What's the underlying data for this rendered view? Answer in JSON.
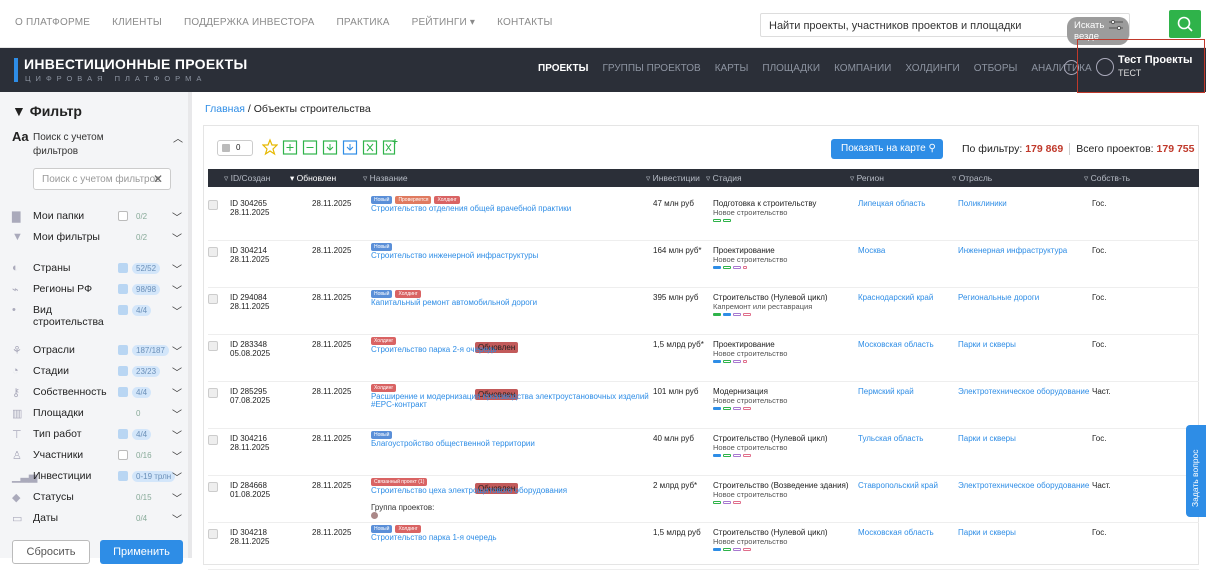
{
  "topnav": [
    "О ПЛАТФОРМЕ",
    "КЛИЕНТЫ",
    "ПОДДЕРЖКА ИНВЕСТОРА",
    "ПРАКТИКА",
    "РЕЙТИНГИ ▾",
    "КОНТАКТЫ"
  ],
  "search": {
    "placeholder": "Найти проекты, участников проектов и площадки",
    "scope": "Искать везде"
  },
  "logo": {
    "main": "ИНВЕСТИЦИОННЫЕ ПРОЕКТЫ",
    "sub": "ЦИФРОВАЯ ПЛАТФОРМА"
  },
  "mainnav": [
    "ПРОЕКТЫ",
    "ГРУППЫ ПРОЕКТОВ",
    "КАРТЫ",
    "ПЛОЩАДКИ",
    "КОМПАНИИ",
    "ХОЛДИНГИ",
    "ОТБОРЫ",
    "АНАЛИТИКА"
  ],
  "user": {
    "name": "Тест Проекты",
    "sub": "ТЕСТ"
  },
  "filter": {
    "title": "Фильтр",
    "aa": "Aa",
    "search_label1": "Поиск с учетом",
    "search_label2": "фильтров",
    "search_placeholder": "Поиск с учетом фильтров",
    "rows": [
      {
        "label": "Мои папки",
        "badge": "0/2"
      },
      {
        "label": "Мои фильтры",
        "badge": "0/2"
      },
      {
        "label": "Страны",
        "badge": "52/52"
      },
      {
        "label": "Регионы РФ",
        "badge": "98/98"
      },
      {
        "label": "Вид",
        "label2": "строительства",
        "badge": "4/4"
      },
      {
        "label": "Отрасли",
        "badge": "187/187"
      },
      {
        "label": "Стадии",
        "badge": "23/23"
      },
      {
        "label": "Собственность",
        "badge": "4/4"
      },
      {
        "label": "Площадки",
        "badge": "0"
      },
      {
        "label": "Тип работ",
        "badge": "4/4"
      },
      {
        "label": "Участники",
        "badge": "0/16"
      },
      {
        "label": "Инвестиции",
        "badge": "0-19 трлн"
      },
      {
        "label": "Статусы",
        "badge": "0/15"
      },
      {
        "label": "Даты",
        "badge": "0/4"
      }
    ],
    "reset": "Сбросить",
    "apply": "Применить"
  },
  "breadcrumb": {
    "home": "Главная",
    "sep": " / ",
    "current": "Объекты строительства"
  },
  "toolbar": {
    "selected": "0",
    "map": "Показать на карте"
  },
  "stats": {
    "label1": "По фильтру:",
    "v1": "179 869",
    "label2": "Всего проектов:",
    "v2": "179 755"
  },
  "columns": [
    "▿ ID/Создан",
    "▾ Обновлен",
    "▿ Название",
    "▿ Инвестиции",
    "▿ Стадия",
    "▿ Регион",
    "▿ Отрасль",
    "▿ Собств-ть"
  ],
  "rows": [
    {
      "id": "ID 304265",
      "date": "28.11.2025",
      "upd": "28.11.2025",
      "tags": [
        "Новый",
        "Проверяется",
        "Холдинг"
      ],
      "name": "Строительство отделения общей врачебной практики",
      "inv": "47 млн руб",
      "stage": "Подготовка к строительству",
      "stage2": "Новое строительство",
      "region": "Липецкая область",
      "industry": "Поликлиники",
      "own": "Гос."
    },
    {
      "id": "ID 304214",
      "date": "28.11.2025",
      "upd": "28.11.2025",
      "tags": [
        "Новый"
      ],
      "name": "Строительство инженерной инфраструктуры",
      "inv": "164 млн руб*",
      "stage": "Проектирование",
      "stage2": "Новое строительство",
      "region": "Москва",
      "industry": "Инженерная инфраструктура",
      "own": "Гос."
    },
    {
      "id": "ID 294084",
      "date": "28.11.2025",
      "upd": "28.11.2025",
      "tags": [
        "Новый",
        "Холдинг"
      ],
      "name": "Капитальный ремонт автомобильной дороги",
      "inv": "395 млн руб",
      "stage": "Строительство (Нулевой цикл)",
      "stage2": "Капремонт или реставрация",
      "region": "Краснодарский край",
      "industry": "Региональные дороги",
      "own": "Гос."
    },
    {
      "id": "ID 283348",
      "date": "05.08.2025",
      "upd": "28.11.2025",
      "tags": [
        "Обновлен",
        "Холдинг"
      ],
      "name": "Строительство парка 2-я очередь",
      "inv": "1,5 млрд руб*",
      "stage": "Проектирование",
      "stage2": "Новое строительство",
      "region": "Московская область",
      "industry": "Парки и скверы",
      "own": "Гос."
    },
    {
      "id": "ID 285295",
      "date": "07.08.2025",
      "upd": "28.11.2025",
      "tags": [
        "Обновлен",
        "Холдинг"
      ],
      "name": "Расширение и модернизация производства электроустановочных изделий",
      "name2": "#EPC-контракт",
      "inv": "101 млн руб",
      "stage": "Модернизация",
      "stage2": "Новое строительство",
      "region": "Пермский край",
      "industry": "Электротехническое оборудование",
      "own": "Част."
    },
    {
      "id": "ID 304216",
      "date": "28.11.2025",
      "upd": "28.11.2025",
      "tags": [
        "Новый"
      ],
      "name": "Благоустройство общественной территории",
      "inv": "40 млн руб",
      "stage": "Строительство (Нулевой цикл)",
      "stage2": "Новое строительство",
      "region": "Тульская область",
      "industry": "Парки и скверы",
      "own": "Гос."
    },
    {
      "id": "ID 284668",
      "date": "01.08.2025",
      "upd": "28.11.2025",
      "tags": [
        "Обновлен",
        "Связанный проект (1)"
      ],
      "name": "Строительство цеха электрощитового оборудования",
      "grp": "Группа проектов:",
      "inv": "2 млрд руб*",
      "stage": "Строительство (Возведение здания)",
      "stage2": "Новое строительство",
      "region": "Ставропольский край",
      "industry": "Электротехническое оборудование",
      "own": "Част."
    },
    {
      "id": "ID 304218",
      "date": "28.11.2025",
      "upd": "28.11.2025",
      "tags": [
        "Новый",
        "Холдинг"
      ],
      "name": "Строительство парка 1-я очередь",
      "inv": "1,5 млрд руб",
      "stage": "Строительство (Нулевой цикл)",
      "stage2": "Новое строительство",
      "region": "Московская область",
      "industry": "Парки и скверы",
      "own": "Гос."
    }
  ],
  "ask": "Задать вопрос"
}
